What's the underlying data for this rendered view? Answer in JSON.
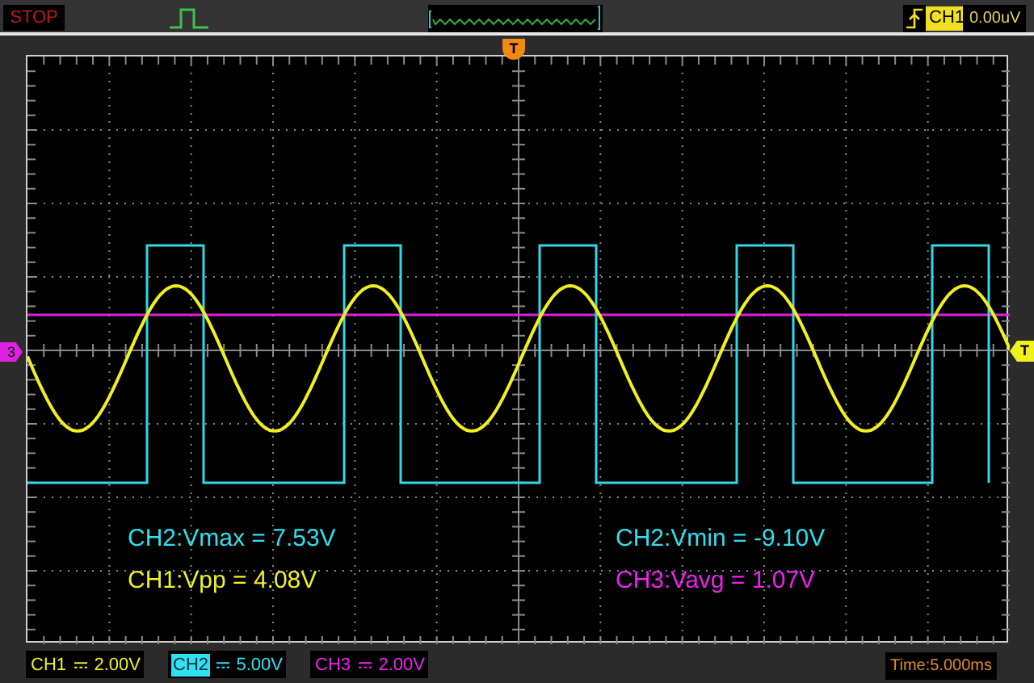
{
  "status": "STOP",
  "trigger": {
    "channel": "CH1",
    "level": "0.00uV"
  },
  "top_marker": "T",
  "left_marker": "3",
  "right_marker": "T",
  "measurements": [
    {
      "text": "CH2:Vmax = 7.53V",
      "color": "#2ee0f0"
    },
    {
      "text": "CH2:Vmin = -9.10V",
      "color": "#2ee0f0"
    },
    {
      "text": "CH1:Vpp = 4.08V",
      "color": "#f0f020"
    },
    {
      "text": "CH3:Vavg = 1.07V",
      "color": "#f020f0"
    }
  ],
  "channels": [
    {
      "name": "CH1",
      "scale": "2.00V",
      "color": "#f0f020",
      "selected": false
    },
    {
      "name": "CH2",
      "scale": "5.00V",
      "color": "#2ee0f0",
      "selected": true
    },
    {
      "name": "CH3",
      "scale": "2.00V",
      "color": "#f020f0",
      "selected": false
    }
  ],
  "time": "Time:5.000ms"
}
